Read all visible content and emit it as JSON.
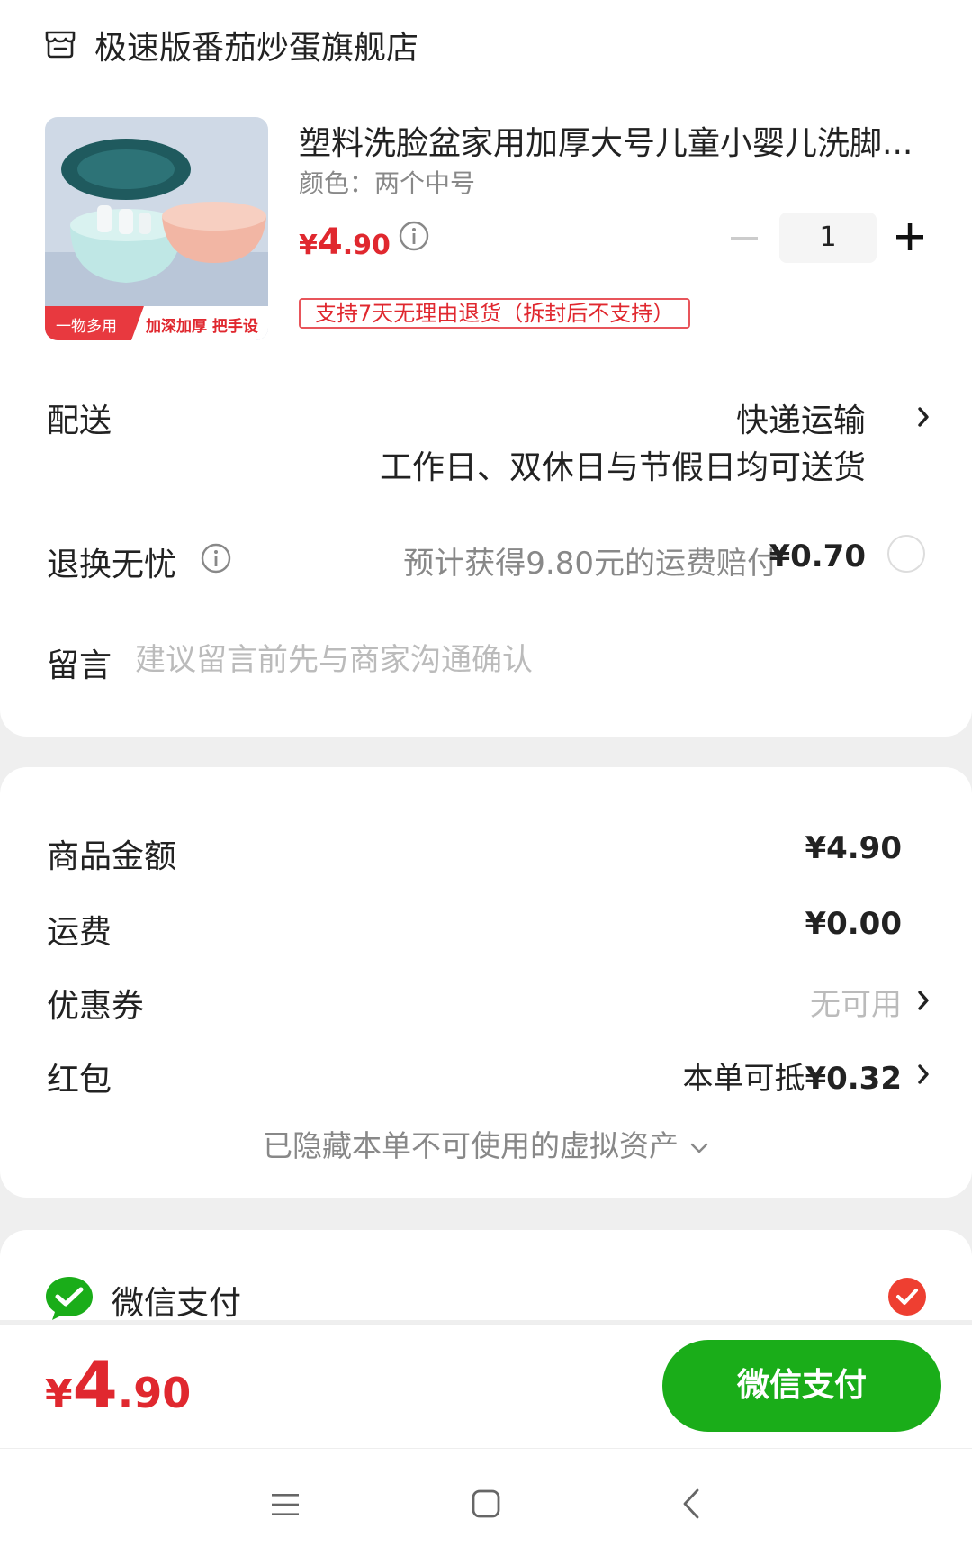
{
  "store": {
    "name": "极速版番茄炒蛋旗舰店",
    "icon": "store-icon"
  },
  "product": {
    "title": "塑料洗脸盆家用加厚大号儿童小婴儿洗脚...",
    "variant": "颜色：两个中号",
    "price_symbol": "¥",
    "price_int": "4",
    "price_dec": ".90",
    "quantity": "1",
    "return_policy": "支持7天无理由退货（拆封后不支持）",
    "image_labels": {
      "left": "一物多用",
      "right": "加深加厚 把手设计"
    }
  },
  "delivery": {
    "label": "配送",
    "method": "快递运输",
    "note": "工作日、双休日与节假日均可送货"
  },
  "returns": {
    "label": "退换无忧",
    "desc": "预计获得9.80元的运费赔付",
    "price": "¥0.70"
  },
  "message": {
    "label": "留言",
    "placeholder": "建议留言前先与商家沟通确认"
  },
  "summary": {
    "goods_label": "商品金额",
    "goods_value": "¥4.90",
    "shipping_label": "运费",
    "shipping_value": "¥0.00",
    "coupon_label": "优惠券",
    "coupon_value": "无可用",
    "redpacket_label": "红包",
    "redpacket_prefix": "本单可抵",
    "redpacket_amount": "¥0.32",
    "hidden_assets": "已隐藏本单不可使用的虚拟资产"
  },
  "payment": {
    "method_label": "微信支付",
    "selected": true
  },
  "footer": {
    "total_symbol": "¥",
    "total_int": "4",
    "total_dec": ".90",
    "pay_button": "微信支付"
  },
  "colors": {
    "price_red": "#e0282f",
    "wechat_green": "#1aad19",
    "check_red": "#ee3f31"
  }
}
